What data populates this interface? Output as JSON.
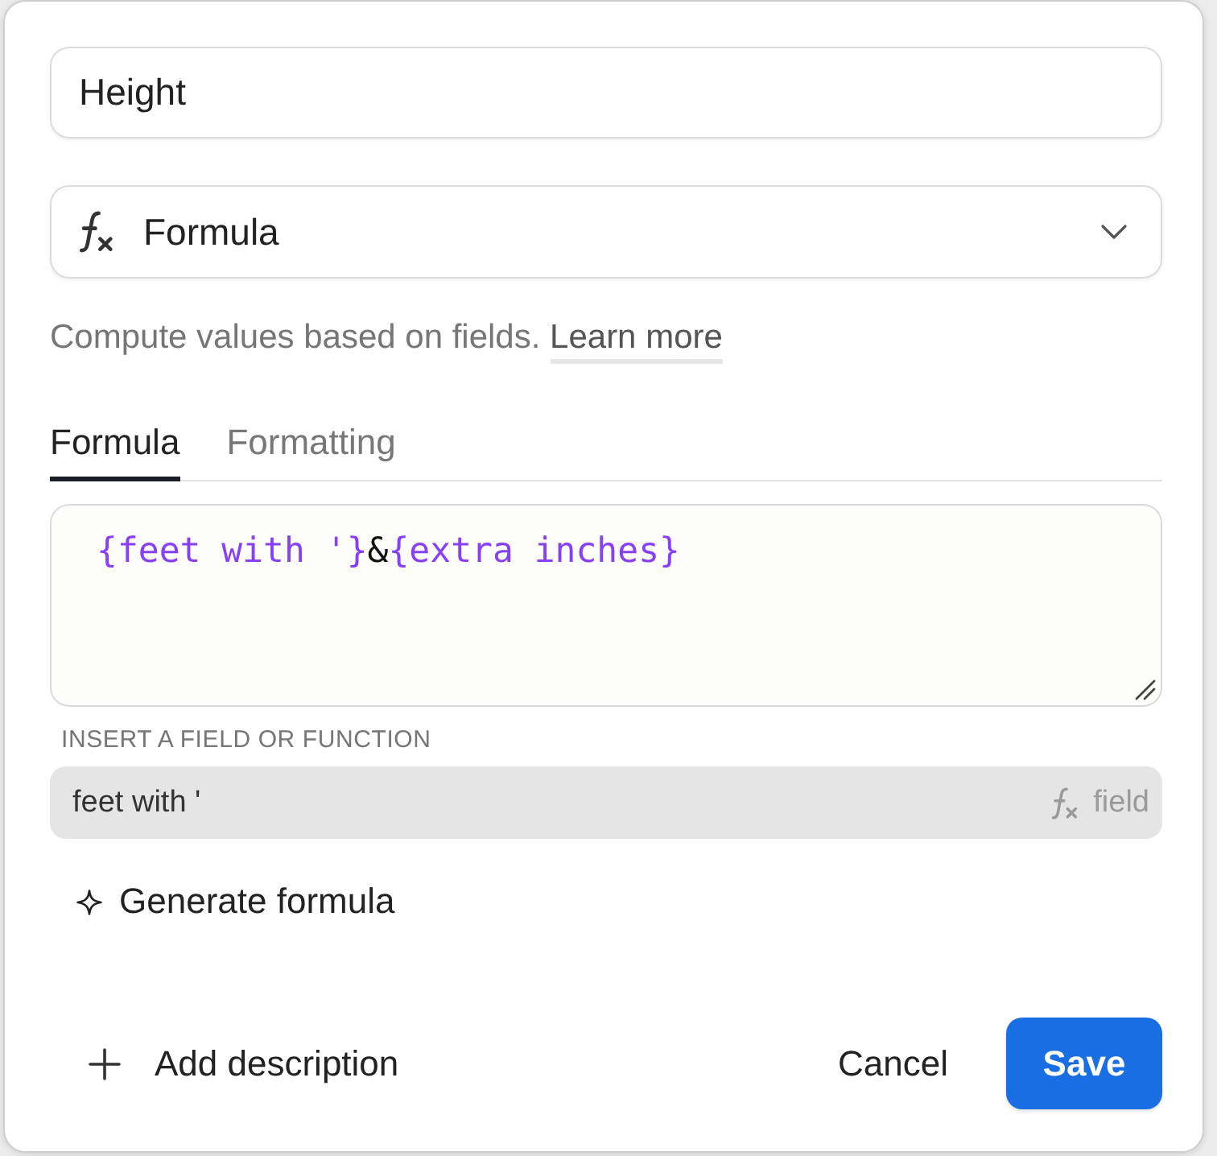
{
  "name_field": {
    "value": "Height"
  },
  "type_select": {
    "value": "Formula"
  },
  "help": {
    "text": "Compute values based on fields.",
    "link": "Learn more"
  },
  "tabs": [
    {
      "label": "Formula",
      "selected": true
    },
    {
      "label": "Formatting",
      "selected": false
    }
  ],
  "formula": {
    "tokens": [
      {
        "text": "{feet with '}",
        "kind": "field"
      },
      {
        "text": "&",
        "kind": "operator"
      },
      {
        "text": "{extra inches}",
        "kind": "field"
      }
    ]
  },
  "suggestions": {
    "heading": "INSERT A FIELD OR FUNCTION",
    "items": [
      {
        "name": "feet with '",
        "type": "field",
        "selected": true
      }
    ]
  },
  "generate_button": {
    "label": "Generate formula"
  },
  "footer": {
    "add_description": "Add description",
    "buttons": [
      {
        "label": "Cancel",
        "kind": "secondary"
      },
      {
        "label": "Save",
        "kind": "primary"
      }
    ]
  }
}
